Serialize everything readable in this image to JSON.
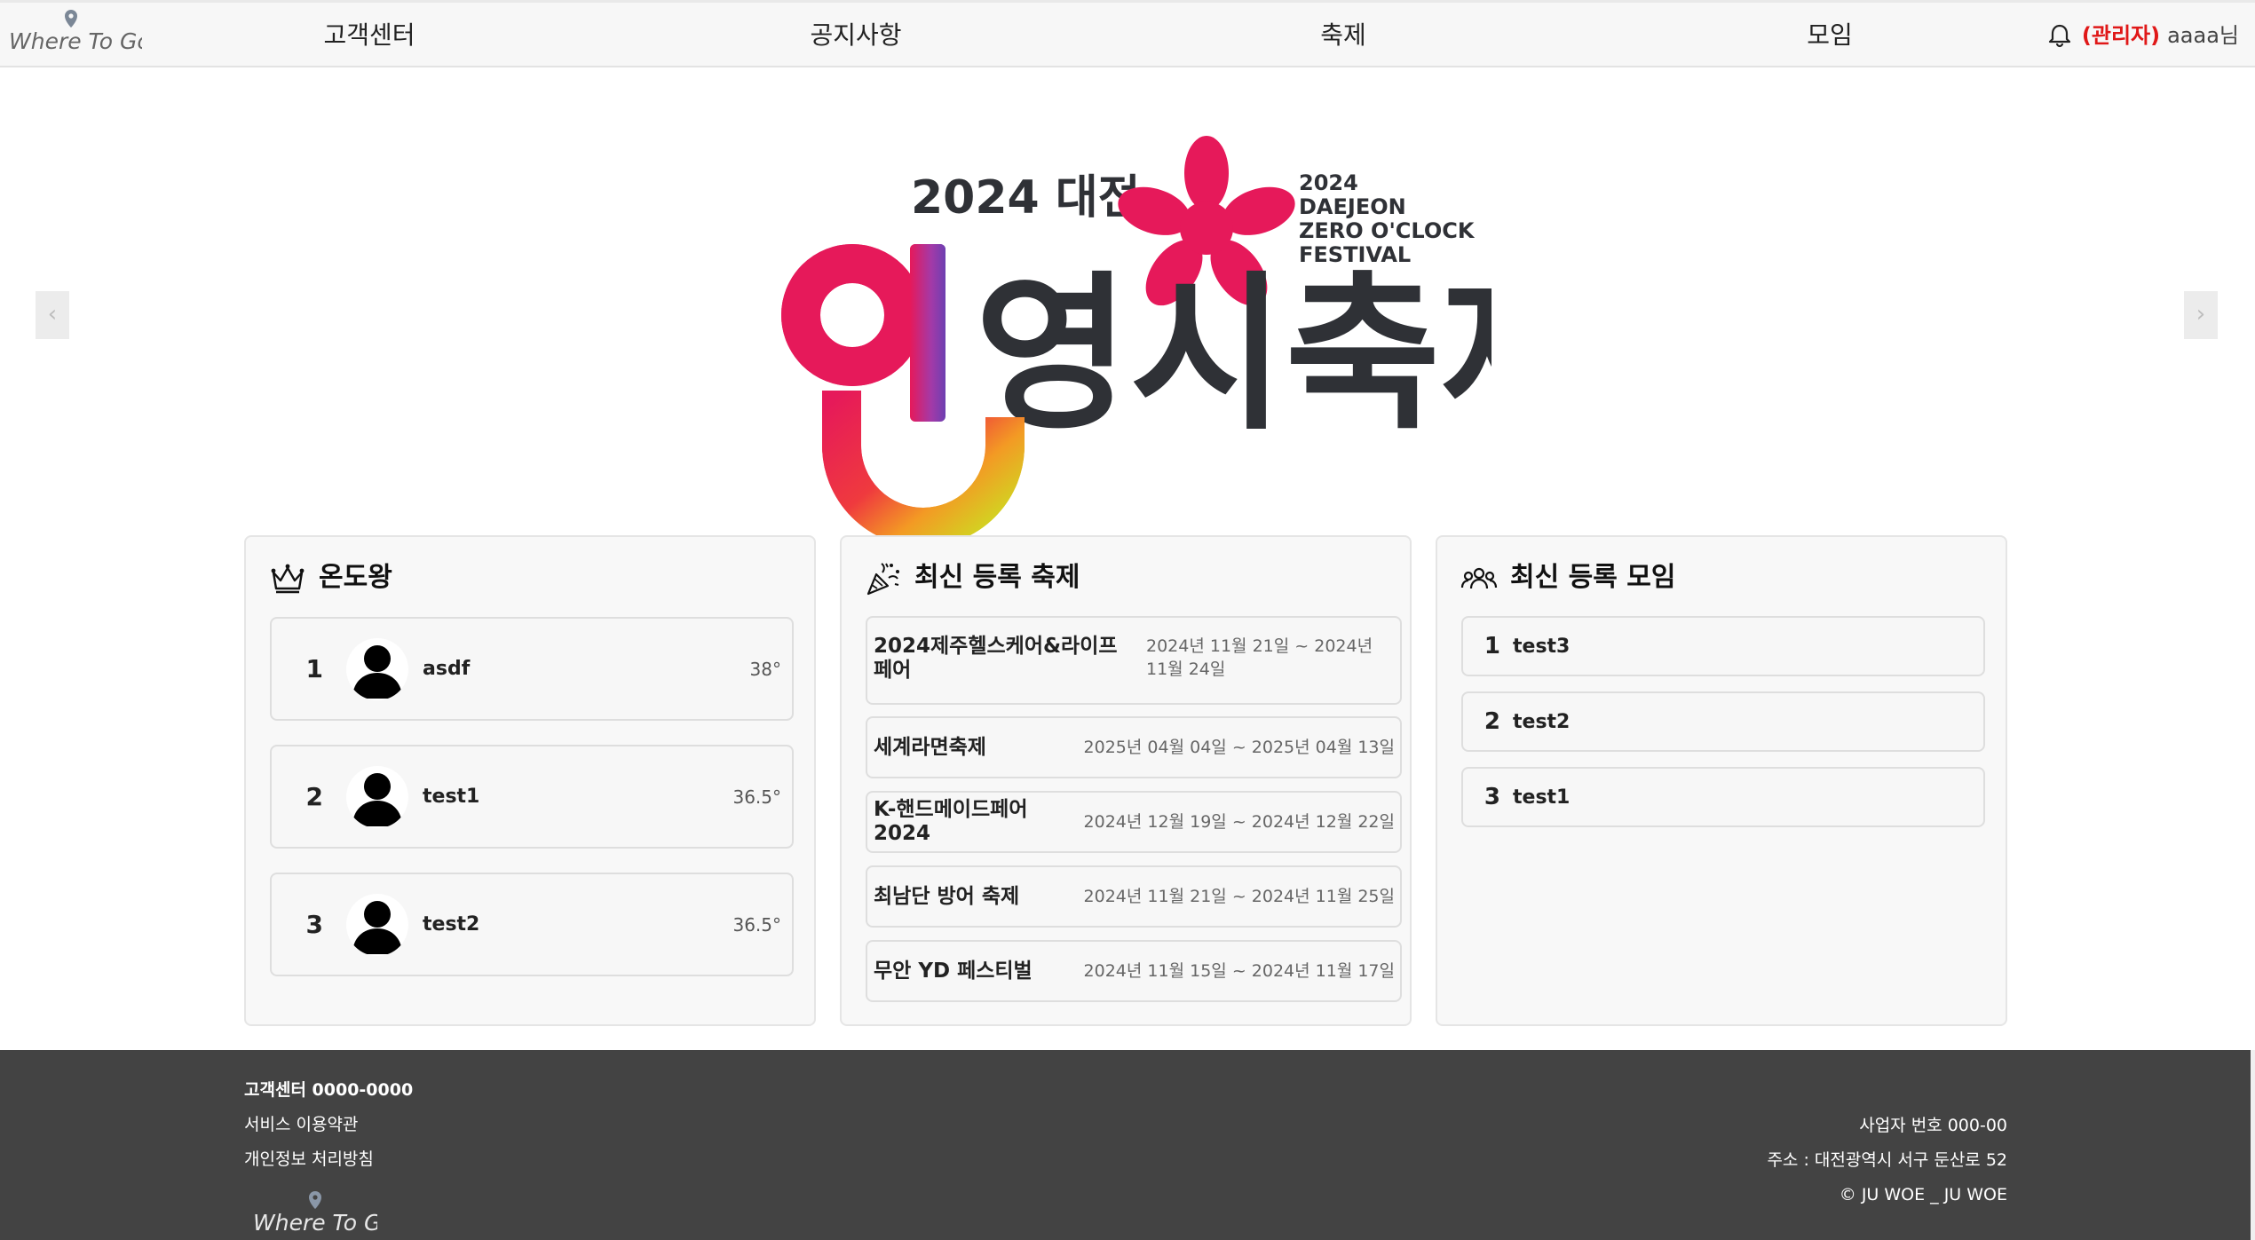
{
  "header": {
    "logo_text": "Where To Go",
    "nav": [
      "고객센터",
      "공지사항",
      "축제",
      "모임"
    ],
    "admin_tag": "(관리자)",
    "username": "aaaa님"
  },
  "banner": {
    "year_city": "2024 대전",
    "title": "영시축제",
    "english_lines": [
      "2024",
      "DAEJEON",
      "ZERO O'CLOCK",
      "FESTIVAL"
    ],
    "prev_label": "‹",
    "next_label": "›"
  },
  "ranking": {
    "title": "온도왕",
    "items": [
      {
        "rank": "1",
        "name": "asdf",
        "temp": "38°"
      },
      {
        "rank": "2",
        "name": "test1",
        "temp": "36.5°"
      },
      {
        "rank": "3",
        "name": "test2",
        "temp": "36.5°"
      }
    ]
  },
  "festivals": {
    "title": "최신 등록 축제",
    "items": [
      {
        "name": "2024제주헬스케어&라이프페어",
        "date": "2024년 11월 21일 ~ 2024년 11월 24일"
      },
      {
        "name": "세계라면축제",
        "date": "2025년 04월 04일 ~ 2025년 04월 13일"
      },
      {
        "name": "K-핸드메이드페어 2024",
        "date": "2024년 12월 19일 ~ 2024년 12월 22일"
      },
      {
        "name": "최남단 방어 축제",
        "date": "2024년 11월 21일 ~ 2024년 11월 25일"
      },
      {
        "name": "무안 YD 페스티벌",
        "date": "2024년 11월 15일 ~ 2024년 11월 17일"
      }
    ]
  },
  "meetings": {
    "title": "최신 등록 모임",
    "items": [
      {
        "rank": "1",
        "name": "test3"
      },
      {
        "rank": "2",
        "name": "test2"
      },
      {
        "rank": "3",
        "name": "test1"
      }
    ]
  },
  "footer": {
    "phone": "고객센터 0000-0000",
    "terms": "서비스 이용약관",
    "privacy": "개인정보 처리방침",
    "logo_text": "Where To Go",
    "business_no": "사업자 번호 000-00",
    "address": "주소 : 대전광역시 서구 둔산로 52",
    "copyright": "© JU WOE _ JU WOE"
  },
  "colors": {
    "accent_pink": "#e6195a",
    "admin_red": "#e01818",
    "footer_bg": "#434343",
    "banner_text_dark": "#2f3136"
  },
  "icons": [
    "pin-icon",
    "bell-icon",
    "crown-icon",
    "party-popper-icon",
    "group-icon",
    "user-avatar-icon"
  ]
}
